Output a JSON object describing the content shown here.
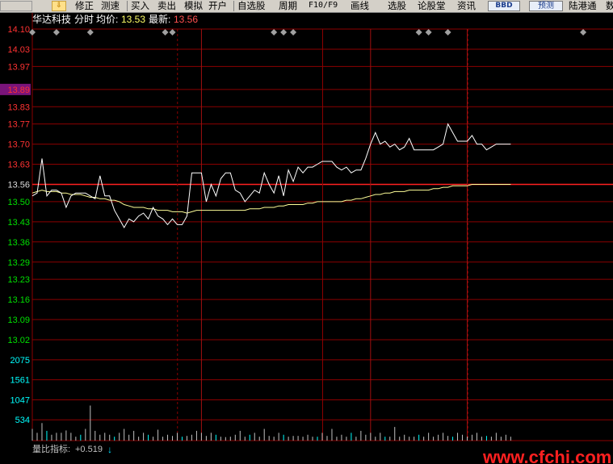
{
  "toolbar": {
    "items": [
      "修正",
      "测速",
      "买入",
      "卖出",
      "模拟",
      "开户",
      "自选股",
      "周期",
      "F10/F9",
      "画线",
      "选股",
      "论股堂",
      "资讯",
      "BBD",
      "预测",
      "陆港通",
      "数"
    ]
  },
  "header": {
    "stock_name": "华达科技",
    "mode": "分时",
    "avg_label": "均价:",
    "avg_value": "13.53",
    "last_label": "最新:",
    "last_value": "13.56"
  },
  "colors": {
    "up": "#ff3232",
    "down": "#00e000",
    "grid": "#8b0000",
    "price_line": "#ffffff",
    "avg_line": "#ffff99",
    "volume": "#c0c0c0",
    "volume_label": "#00ffff",
    "highlight_bg": "#7a147a"
  },
  "chart_data": {
    "type": "line",
    "price_ticks": [
      "14.10",
      "14.03",
      "13.97",
      "13.89",
      "13.83",
      "13.77",
      "13.70",
      "13.63",
      "13.56",
      "13.50",
      "13.43",
      "13.36",
      "13.29",
      "13.23",
      "13.16",
      "13.09",
      "13.02"
    ],
    "highlighted_tick": "13.89",
    "prev_close": 13.56,
    "ylim": [
      13.02,
      14.1
    ],
    "volume_ticks": [
      "2075",
      "1561",
      "1047",
      "534"
    ],
    "volume_ylim": [
      0,
      2589
    ],
    "x": [
      0,
      2,
      4,
      6,
      8,
      10,
      12,
      14,
      16,
      18,
      20,
      22,
      24,
      26,
      28,
      30,
      32,
      34,
      36,
      38,
      40,
      42,
      44,
      46,
      48,
      50,
      52,
      54,
      56,
      58,
      60,
      62,
      64,
      66,
      68,
      70,
      72,
      74,
      76,
      78,
      80,
      82,
      84,
      86,
      88,
      90,
      92,
      94,
      96,
      98,
      100,
      102,
      104,
      106,
      108,
      110,
      112,
      114,
      116,
      118,
      120,
      122,
      124,
      126,
      128,
      130,
      132,
      134,
      136,
      138,
      140,
      142,
      144,
      146,
      148,
      150,
      152,
      154,
      156,
      158,
      160,
      162,
      164,
      166,
      168,
      170,
      172,
      174,
      176,
      178,
      180,
      182,
      184,
      186,
      188,
      190,
      192,
      194,
      196,
      198,
      200,
      202,
      204,
      206,
      208,
      210,
      212,
      214,
      216,
      218,
      220,
      222,
      224,
      226,
      228,
      230,
      232,
      234,
      236,
      238,
      240
    ],
    "series": [
      {
        "name": "price",
        "values": [
          13.52,
          13.53,
          13.65,
          13.52,
          13.54,
          13.54,
          13.53,
          13.48,
          13.52,
          13.53,
          13.53,
          13.53,
          13.52,
          13.51,
          13.59,
          13.52,
          13.52,
          13.47,
          13.44,
          13.41,
          13.44,
          13.43,
          13.45,
          13.46,
          13.44,
          13.48,
          13.45,
          13.44,
          13.42,
          13.44,
          13.42,
          13.42,
          13.45,
          13.6,
          13.6,
          13.6,
          13.5,
          13.56,
          13.52,
          13.58,
          13.6,
          13.6,
          13.54,
          13.53,
          13.5,
          13.52,
          13.54,
          13.53,
          13.6,
          13.56,
          13.53,
          13.59,
          13.52,
          13.61,
          13.57,
          13.62,
          13.6,
          13.62,
          13.62,
          13.63,
          13.64,
          13.64,
          13.64,
          13.62,
          13.61,
          13.62,
          13.6,
          13.61,
          13.61,
          13.65,
          13.7,
          13.74,
          13.7,
          13.71,
          13.69,
          13.7,
          13.68,
          13.69,
          13.72,
          13.68,
          13.68,
          13.68,
          13.68,
          13.68,
          13.69,
          13.7,
          13.77,
          13.74,
          13.71,
          13.71,
          13.71,
          13.73,
          13.7,
          13.7,
          13.68,
          13.69,
          13.7,
          13.7,
          13.7,
          13.7
        ],
        "avg_values": [
          13.53,
          13.535,
          13.54,
          13.535,
          13.535,
          13.535,
          13.53,
          13.53,
          13.525,
          13.525,
          13.525,
          13.52,
          13.515,
          13.515,
          13.51,
          13.51,
          13.505,
          13.505,
          13.5,
          13.49,
          13.485,
          13.48,
          13.48,
          13.48,
          13.475,
          13.475,
          13.47,
          13.47,
          13.47,
          13.465,
          13.465,
          13.465,
          13.46,
          13.465,
          13.47,
          13.47,
          13.47,
          13.47,
          13.47,
          13.47,
          13.47,
          13.47,
          13.47,
          13.47,
          13.47,
          13.475,
          13.475,
          13.475,
          13.48,
          13.48,
          13.48,
          13.485,
          13.485,
          13.49,
          13.49,
          13.49,
          13.49,
          13.495,
          13.495,
          13.5,
          13.5,
          13.5,
          13.5,
          13.5,
          13.5,
          13.505,
          13.505,
          13.51,
          13.51,
          13.515,
          13.52,
          13.525,
          13.525,
          13.53,
          13.53,
          13.535,
          13.535,
          13.535,
          13.54,
          13.54,
          13.54,
          13.54,
          13.54,
          13.545,
          13.545,
          13.55,
          13.55,
          13.555,
          13.555,
          13.555,
          13.555,
          13.56,
          13.56,
          13.56,
          13.56,
          13.56,
          13.56,
          13.56,
          13.56,
          13.56
        ]
      },
      {
        "name": "volume",
        "values": [
          300,
          200,
          450,
          250,
          150,
          200,
          200,
          260,
          200,
          100,
          150,
          300,
          900,
          250,
          150,
          200,
          150,
          100,
          200,
          300,
          150,
          250,
          100,
          200,
          150,
          100,
          280,
          100,
          150,
          120,
          200,
          100,
          120,
          150,
          250,
          200,
          120,
          200,
          150,
          100,
          90,
          100,
          150,
          250,
          100,
          150,
          200,
          100,
          300,
          120,
          100,
          200,
          150,
          100,
          120,
          120,
          100,
          150,
          100,
          100,
          200,
          120,
          300,
          100,
          150,
          100,
          200,
          100,
          250,
          150,
          200,
          100,
          200,
          100,
          100,
          350,
          100,
          150,
          100,
          100,
          150,
          100,
          200,
          100,
          150,
          200,
          120,
          100,
          200,
          150,
          100,
          150,
          200,
          100,
          120,
          100,
          200,
          100,
          150,
          100
        ]
      }
    ],
    "time_markers": [
      0,
      10,
      24,
      55,
      58,
      100,
      104,
      108,
      160,
      164,
      172,
      228
    ],
    "vertical_highlight_x": [
      70,
      140,
      180
    ]
  },
  "footer": {
    "ratio_label": "量比指标:",
    "ratio_value": "+0.519",
    "ratio_arrow": "↓",
    "watermark": "www.cfchi.com"
  }
}
